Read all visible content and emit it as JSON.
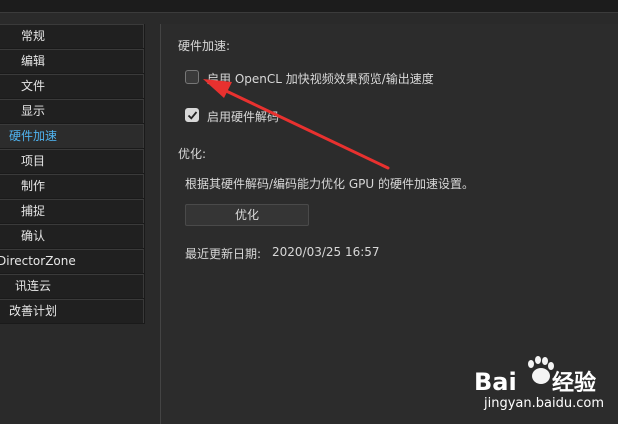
{
  "sidebar": {
    "items": [
      {
        "label": "常规",
        "active": false
      },
      {
        "label": "编辑",
        "active": false
      },
      {
        "label": "文件",
        "active": false
      },
      {
        "label": "显示",
        "active": false
      },
      {
        "label": "硬件加速",
        "active": true
      },
      {
        "label": "项目",
        "active": false
      },
      {
        "label": "制作",
        "active": false
      },
      {
        "label": "捕捉",
        "active": false
      },
      {
        "label": "确认",
        "active": false
      },
      {
        "label": "DirectorZone",
        "active": false
      },
      {
        "label": "讯连云",
        "active": false
      },
      {
        "label": "改善计划",
        "active": false
      }
    ]
  },
  "hardware": {
    "section_title": "硬件加速:",
    "opencl_label": "启用 OpenCL 加快视频效果预览/输出速度",
    "opencl_checked": false,
    "hw_decode_label": "启用硬件解码",
    "hw_decode_checked": true
  },
  "optimize": {
    "section_title": "优化:",
    "description": "根据其硬件解码/编码能力优化 GPU 的硬件加速设置。",
    "button_label": "优化",
    "last_update_label": "最近更新日期:",
    "last_update_value": "2020/03/25 16:57"
  },
  "annotation": {
    "arrow_color": "#e8312f"
  },
  "watermark": {
    "brand": "Bai du 经验",
    "url": "jingyan.baidu.com"
  },
  "colors": {
    "accent": "#4fb3f0",
    "background": "#2c2c2c"
  }
}
